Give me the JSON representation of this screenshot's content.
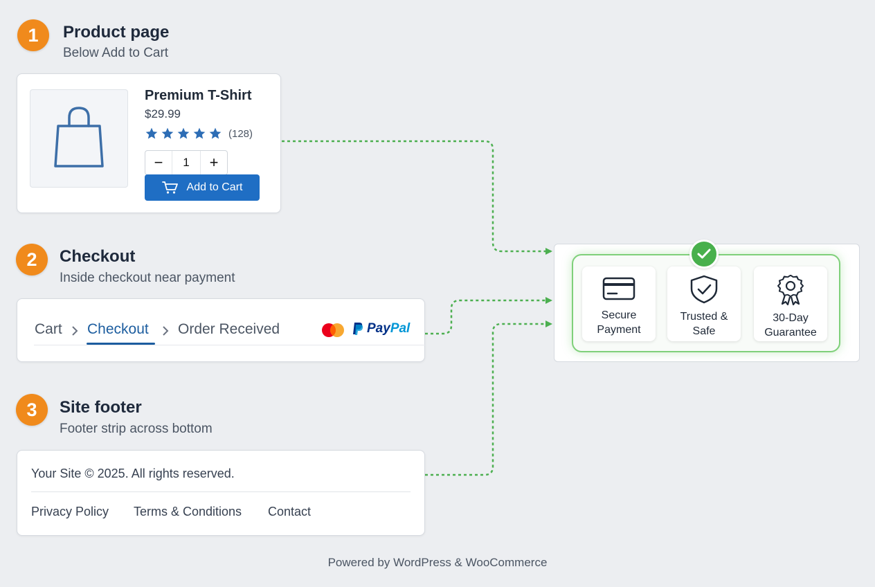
{
  "sections": [
    {
      "number": "1",
      "title": "Product page",
      "subtitle": "Below Add to Cart"
    },
    {
      "number": "2",
      "title": "Checkout",
      "subtitle": "Inside checkout near payment"
    },
    {
      "number": "3",
      "title": "Site footer",
      "subtitle": "Footer strip across bottom"
    }
  ],
  "product": {
    "icon": "shopping-bag-icon",
    "name": "Premium T-Shirt",
    "price": "$29.99",
    "rating": 5,
    "rating_max": 5,
    "rating_count": "(128)",
    "quantity": "1",
    "decrement_label": "−",
    "increment_label": "+",
    "add_to_cart_label": "Add to Cart",
    "star_color": "#2d6db5",
    "button_color": "#1f6ec4"
  },
  "checkout": {
    "breadcrumbs": [
      "Cart",
      "Checkout",
      "Order Received"
    ],
    "active_step": "Checkout",
    "payment_brand_1": "PayPal-pay",
    "payment_brand_2": "Pal",
    "payment_icons": [
      "mastercard-icon",
      "paypal-icon"
    ]
  },
  "footer": {
    "copyright": "Your Site © 2025. All rights reserved.",
    "links": [
      "Privacy Policy",
      "Terms & Conditions",
      "Contact"
    ]
  },
  "trust_badges": {
    "items": [
      {
        "icon": "credit-card-icon",
        "line1": "Secure",
        "line2": "Payment"
      },
      {
        "icon": "shield-check-icon",
        "line1": "Trusted &",
        "line2": "Safe"
      },
      {
        "icon": "award-ribbon-icon",
        "line1": "30-Day",
        "line2": "Guarantee"
      }
    ],
    "accent_color": "#48b04c"
  },
  "powered_by": "Powered by WordPress & WooCommerce",
  "colors": {
    "step_badge": "#f08a1c",
    "connector": "#4caf50",
    "link_active": "#1c5d9f"
  }
}
